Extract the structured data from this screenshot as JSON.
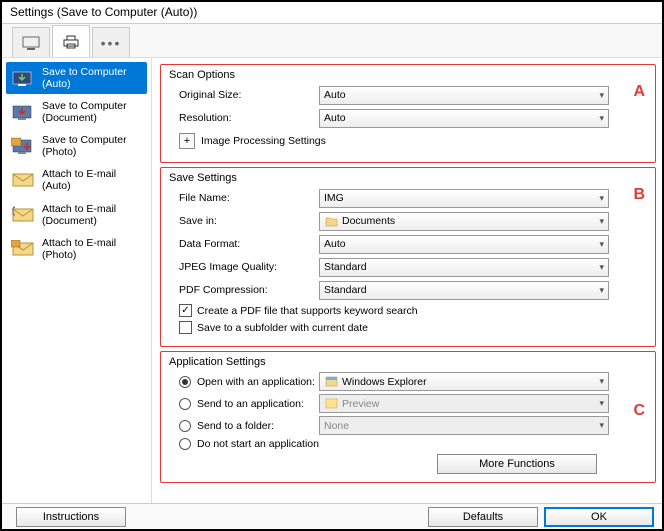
{
  "window": {
    "title": "Settings (Save to Computer (Auto))"
  },
  "sidebar": {
    "items": [
      {
        "label": "Save to Computer\n(Auto)"
      },
      {
        "label": "Save to Computer\n(Document)"
      },
      {
        "label": "Save to Computer\n(Photo)"
      },
      {
        "label": "Attach to E-mail\n(Auto)"
      },
      {
        "label": "Attach to E-mail\n(Document)"
      },
      {
        "label": "Attach to E-mail\n(Photo)"
      }
    ]
  },
  "sectionA": {
    "letter": "A",
    "legend": "Scan Options",
    "original_size_label": "Original Size:",
    "original_size_value": "Auto",
    "resolution_label": "Resolution:",
    "resolution_value": "Auto",
    "plus": "+",
    "image_processing_label": "Image Processing Settings"
  },
  "sectionB": {
    "letter": "B",
    "legend": "Save Settings",
    "file_name_label": "File Name:",
    "file_name_value": "IMG",
    "save_in_label": "Save in:",
    "save_in_value": "Documents",
    "data_format_label": "Data Format:",
    "data_format_value": "Auto",
    "jpeg_label": "JPEG Image Quality:",
    "jpeg_value": "Standard",
    "pdf_label": "PDF Compression:",
    "pdf_value": "Standard",
    "chk1_label": "Create a PDF file that supports keyword search",
    "chk2_label": "Save to a subfolder with current date"
  },
  "sectionC": {
    "letter": "C",
    "legend": "Application Settings",
    "r1_label": "Open with an application:",
    "r1_value": "Windows Explorer",
    "r2_label": "Send to an application:",
    "r2_value": "Preview",
    "r3_label": "Send to a folder:",
    "r3_value": "None",
    "r4_label": "Do not start an application",
    "more_functions": "More Functions"
  },
  "footer": {
    "instructions": "Instructions",
    "defaults": "Defaults",
    "ok": "OK"
  }
}
